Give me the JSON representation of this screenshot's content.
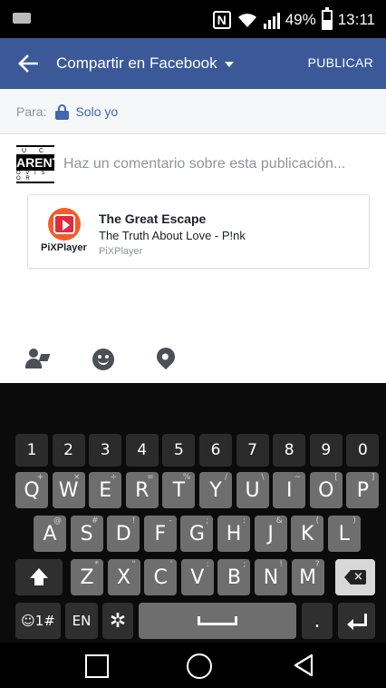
{
  "status_bar": {
    "battery": "49%",
    "battery_level": 0.49,
    "time": "13:11"
  },
  "app_bar": {
    "back_icon": "arrow-left-icon",
    "title": "Compartir en Facebook",
    "publish_label": "PUBLICAR",
    "color": "#3b5998"
  },
  "audience": {
    "label": "Para:",
    "value": "Solo yo",
    "icon": "lock-icon",
    "color": "#4267b2"
  },
  "composer": {
    "avatar": {
      "top": "U C",
      "middle": "ARENTA",
      "bottom": "O V I S O R"
    },
    "placeholder": "Haz un comentario sobre esta publicación..."
  },
  "attachment": {
    "app_name": "PiXPlayer",
    "title": "The Great Escape",
    "subtitle": "The Truth About Love - P!nk",
    "source": "PiXPlayer"
  },
  "actions": [
    "tag-people-icon",
    "feeling-icon",
    "location-pin-icon"
  ],
  "keyboard": {
    "numbers": [
      "1",
      "2",
      "3",
      "4",
      "5",
      "6",
      "7",
      "8",
      "9",
      "0"
    ],
    "row1": [
      {
        "k": "Q",
        "h": "+"
      },
      {
        "k": "W",
        "h": "×"
      },
      {
        "k": "E",
        "h": "÷"
      },
      {
        "k": "R",
        "h": "="
      },
      {
        "k": "T",
        "h": "%"
      },
      {
        "k": "Y",
        "h": "/"
      },
      {
        "k": "U",
        "h": "\\"
      },
      {
        "k": "I",
        "h": "~"
      },
      {
        "k": "O",
        "h": "["
      },
      {
        "k": "P",
        "h": "]"
      }
    ],
    "row2": [
      {
        "k": "A",
        "h": "@"
      },
      {
        "k": "S",
        "h": "#"
      },
      {
        "k": "D",
        "h": "!"
      },
      {
        "k": "F",
        "h": "-"
      },
      {
        "k": "G",
        "h": ";"
      },
      {
        "k": "H",
        "h": ":"
      },
      {
        "k": "J",
        "h": "&"
      },
      {
        "k": "K",
        "h": "("
      },
      {
        "k": "L",
        "h": ")"
      }
    ],
    "row3": [
      {
        "k": "Z",
        "h": "*"
      },
      {
        "k": "X",
        "h": "\""
      },
      {
        "k": "C",
        "h": "'"
      },
      {
        "k": "V",
        "h": ":"
      },
      {
        "k": "B",
        "h": ";"
      },
      {
        "k": "N",
        "h": "!"
      },
      {
        "k": "M",
        "h": "?"
      }
    ],
    "sym_label": "☺1#",
    "lang_label": "EN",
    "period_label": "."
  }
}
